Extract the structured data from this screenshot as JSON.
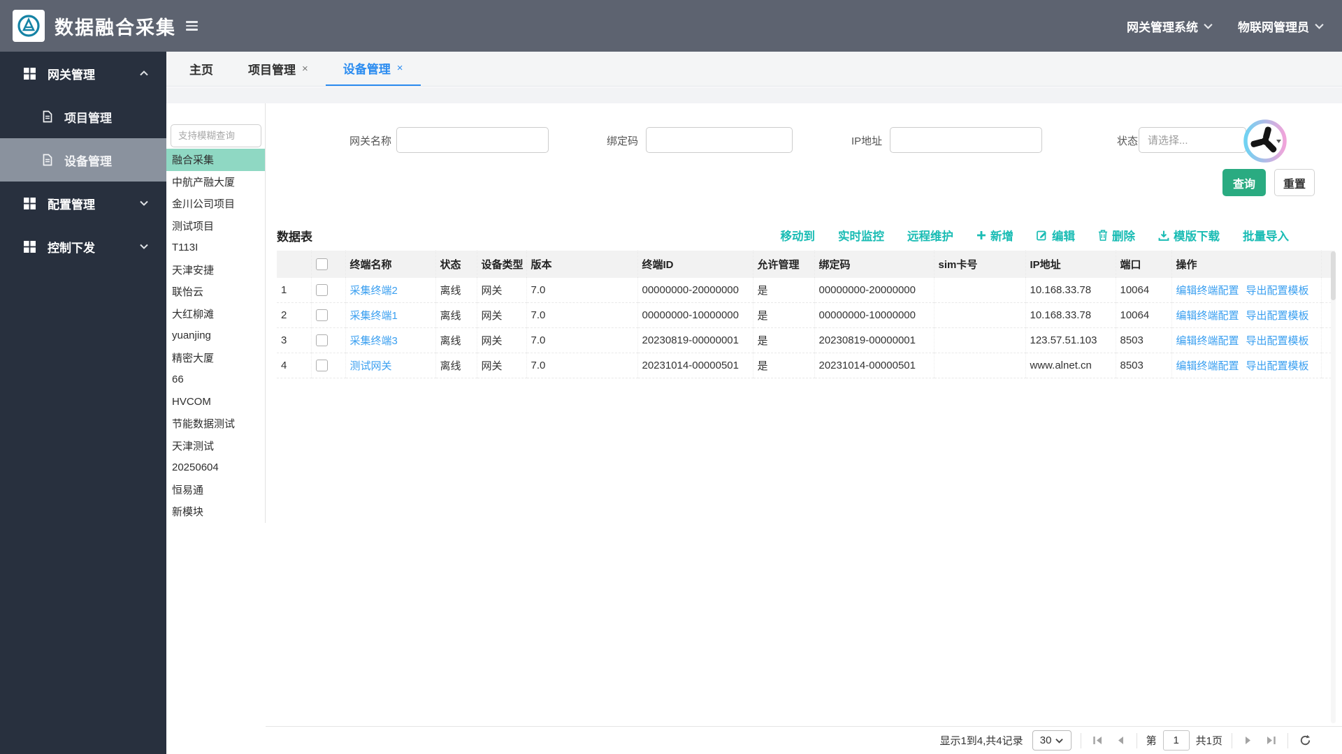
{
  "header": {
    "app_title": "数据融合采集",
    "system_menu": "网关管理系统",
    "user_menu": "物联网管理员"
  },
  "sidebar": {
    "groups": [
      {
        "label": "网关管理",
        "expanded": true,
        "children": [
          {
            "label": "项目管理",
            "active": false
          },
          {
            "label": "设备管理",
            "active": true
          }
        ]
      },
      {
        "label": "配置管理",
        "expanded": false,
        "children": []
      },
      {
        "label": "控制下发",
        "expanded": false,
        "children": []
      }
    ]
  },
  "tabs": [
    {
      "label": "主页",
      "closable": false,
      "active": false
    },
    {
      "label": "项目管理",
      "closable": true,
      "active": false
    },
    {
      "label": "设备管理",
      "closable": true,
      "active": true
    }
  ],
  "project_panel": {
    "search_placeholder": "支持模糊查询",
    "items": [
      {
        "label": "融合采集",
        "selected": true
      },
      {
        "label": "中航产融大厦",
        "selected": false
      },
      {
        "label": "金川公司项目",
        "selected": false
      },
      {
        "label": "测试项目",
        "selected": false
      },
      {
        "label": "T113I",
        "selected": false
      },
      {
        "label": "天津安捷",
        "selected": false
      },
      {
        "label": "联怡云",
        "selected": false
      },
      {
        "label": "大红柳滩",
        "selected": false
      },
      {
        "label": "yuanjing",
        "selected": false
      },
      {
        "label": "精密大厦",
        "selected": false
      },
      {
        "label": "66",
        "selected": false
      },
      {
        "label": "HVCOM",
        "selected": false
      },
      {
        "label": "节能数据测试",
        "selected": false
      },
      {
        "label": "天津测试",
        "selected": false
      },
      {
        "label": "20250604",
        "selected": false
      },
      {
        "label": "恒易通",
        "selected": false
      },
      {
        "label": "新模块",
        "selected": false
      }
    ]
  },
  "filters": {
    "fields": [
      {
        "label": "网关名称",
        "type": "input",
        "value": ""
      },
      {
        "label": "绑定码",
        "type": "input",
        "value": ""
      },
      {
        "label": "IP地址",
        "type": "input",
        "value": ""
      },
      {
        "label": "状态",
        "type": "select",
        "placeholder": "请选择..."
      }
    ],
    "query_button": "查询",
    "reset_button": "重置"
  },
  "table": {
    "title": "数据表",
    "toolbar": [
      {
        "label": "移动到",
        "icon": null
      },
      {
        "label": "实时监控",
        "icon": null
      },
      {
        "label": "远程维护",
        "icon": null
      },
      {
        "label": "新增",
        "icon": "plus-icon"
      },
      {
        "label": "编辑",
        "icon": "edit-icon"
      },
      {
        "label": "删除",
        "icon": "trash-icon"
      },
      {
        "label": "模版下载",
        "icon": "download-icon"
      },
      {
        "label": "批量导入",
        "icon": null
      }
    ],
    "columns": [
      "终端名称",
      "状态",
      "设备类型",
      "版本",
      "终端ID",
      "允许管理",
      "绑定码",
      "sim卡号",
      "IP地址",
      "端口",
      "操作"
    ],
    "rows": [
      {
        "index": "1",
        "name": "采集终端2",
        "status": "离线",
        "device_type": "网关",
        "version": "7.0",
        "terminal_id": "00000000-20000000",
        "managed": "是",
        "binding_code": "00000000-20000000",
        "sim": "",
        "ip": "10.168.33.78",
        "port": "10064"
      },
      {
        "index": "2",
        "name": "采集终端1",
        "status": "离线",
        "device_type": "网关",
        "version": "7.0",
        "terminal_id": "00000000-10000000",
        "managed": "是",
        "binding_code": "00000000-10000000",
        "sim": "",
        "ip": "10.168.33.78",
        "port": "10064"
      },
      {
        "index": "3",
        "name": "采集终端3",
        "status": "离线",
        "device_type": "网关",
        "version": "7.0",
        "terminal_id": "20230819-00000001",
        "managed": "是",
        "binding_code": "20230819-00000001",
        "sim": "",
        "ip": "123.57.51.103",
        "port": "8503"
      },
      {
        "index": "4",
        "name": "测试网关",
        "status": "离线",
        "device_type": "网关",
        "version": "7.0",
        "terminal_id": "20231014-00000501",
        "managed": "是",
        "binding_code": "20231014-00000501",
        "sim": "",
        "ip": "www.alnet.cn",
        "port": "8503"
      }
    ],
    "row_actions": [
      "编辑终端配置",
      "导出配置模板"
    ]
  },
  "pagination": {
    "summary": "显示1到4,共4记录",
    "page_size": "30",
    "page_prefix": "第",
    "current_page": "1",
    "total_pages_label": "共1页"
  },
  "colors": {
    "header_bg": "#5d6370",
    "sidebar_bg": "#28303e",
    "active_tab_blue": "#2b8cf0",
    "toolbar_teal": "#1abcb4",
    "link_blue": "#3a9ff0",
    "query_green": "#2aab81",
    "selected_project_bg": "#8fd8c3"
  }
}
